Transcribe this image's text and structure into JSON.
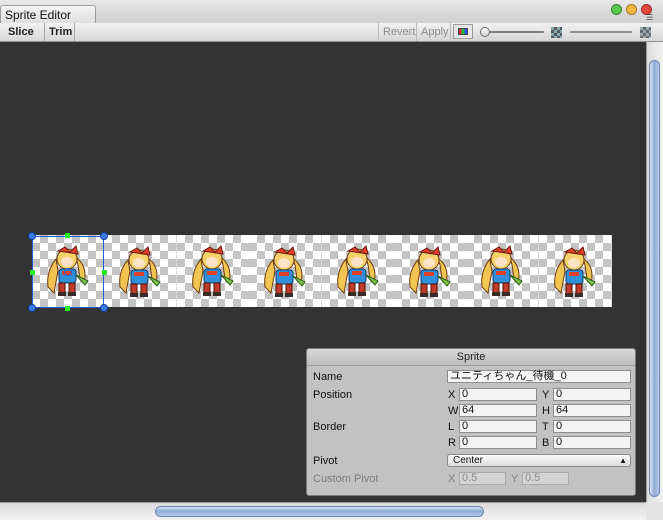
{
  "window": {
    "tab_title": "Sprite Editor",
    "menu_icon": "menu-lines-icon",
    "buttons": [
      {
        "name": "minimize-button",
        "color": "#59c94c"
      },
      {
        "name": "zoom-button",
        "color": "#f3b63a"
      },
      {
        "name": "close-button",
        "color": "#e5483d"
      }
    ]
  },
  "toolbar": {
    "slice_label": "Slice ↕",
    "trim_label": "Trim",
    "revert_label": "Revert",
    "apply_label": "Apply",
    "zoom_slider_value": 0.0,
    "alpha_slider_value": 0.0,
    "icons": [
      "color-channel-icon",
      "checker-icon",
      "checker-icon"
    ]
  },
  "canvas": {
    "background": "#333333",
    "frame_count": 8,
    "selected_frame": 0
  },
  "sprite_panel": {
    "title": "Sprite",
    "name_label": "Name",
    "name_value": "ユニティちゃん_待機_0",
    "position_label": "Position",
    "x_label": "X",
    "x_value": "0",
    "y_label": "Y",
    "y_value": "0",
    "w_label": "W",
    "w_value": "64",
    "h_label": "H",
    "h_value": "64",
    "border_label": "Border",
    "l_label": "L",
    "l_value": "0",
    "t_label": "T",
    "t_value": "0",
    "r_label": "R",
    "r_value": "0",
    "b_label": "B",
    "b_value": "0",
    "pivot_label": "Pivot",
    "pivot_value": "Center",
    "custom_pivot_label": "Custom Pivot",
    "cp_x_label": "X",
    "cp_x_value": "0.5",
    "cp_y_label": "Y",
    "cp_y_value": "0.5"
  },
  "scrollbars": {
    "horizontal_thumb_start": 0.24,
    "horizontal_thumb_end": 0.75,
    "vertical_thumb_start": 0.04,
    "vertical_thumb_end": 0.99
  }
}
